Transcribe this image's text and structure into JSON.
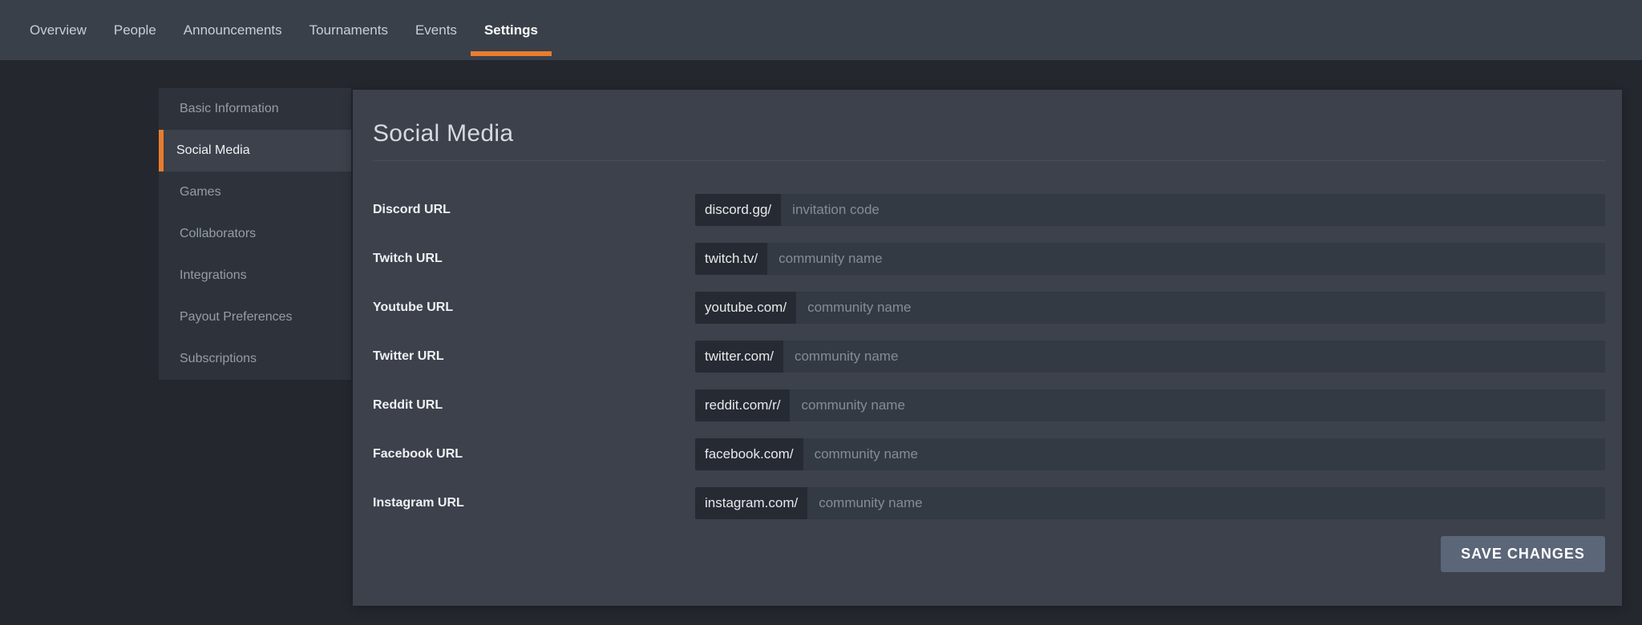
{
  "nav": {
    "items": [
      {
        "label": "Overview",
        "active": false
      },
      {
        "label": "People",
        "active": false
      },
      {
        "label": "Announcements",
        "active": false
      },
      {
        "label": "Tournaments",
        "active": false
      },
      {
        "label": "Events",
        "active": false
      },
      {
        "label": "Settings",
        "active": true
      }
    ]
  },
  "sidebar": {
    "items": [
      {
        "label": "Basic Information",
        "active": false
      },
      {
        "label": "Social Media",
        "active": true
      },
      {
        "label": "Games",
        "active": false
      },
      {
        "label": "Collaborators",
        "active": false
      },
      {
        "label": "Integrations",
        "active": false
      },
      {
        "label": "Payout Preferences",
        "active": false
      },
      {
        "label": "Subscriptions",
        "active": false
      }
    ]
  },
  "main": {
    "title": "Social Media",
    "fields": [
      {
        "id": "discord",
        "label": "Discord URL",
        "prefix": "discord.gg/",
        "placeholder": "invitation code",
        "value": ""
      },
      {
        "id": "twitch",
        "label": "Twitch URL",
        "prefix": "twitch.tv/",
        "placeholder": "community name",
        "value": ""
      },
      {
        "id": "youtube",
        "label": "Youtube URL",
        "prefix": "youtube.com/",
        "placeholder": "community name",
        "value": ""
      },
      {
        "id": "twitter",
        "label": "Twitter URL",
        "prefix": "twitter.com/",
        "placeholder": "community name",
        "value": ""
      },
      {
        "id": "reddit",
        "label": "Reddit URL",
        "prefix": "reddit.com/r/",
        "placeholder": "community name",
        "value": ""
      },
      {
        "id": "facebook",
        "label": "Facebook URL",
        "prefix": "facebook.com/",
        "placeholder": "community name",
        "value": ""
      },
      {
        "id": "instagram",
        "label": "Instagram URL",
        "prefix": "instagram.com/",
        "placeholder": "community name",
        "value": ""
      }
    ],
    "save_label": "SAVE CHANGES"
  },
  "colors": {
    "accent": "#e87d2f",
    "nav_bg": "#3a4049",
    "page_bg": "#24272e",
    "sidebar_bg": "#2e333b",
    "panel_bg": "#3c414b",
    "input_bg": "#343a43",
    "prefix_bg": "#262a32",
    "save_button_bg": "#5c6679"
  }
}
